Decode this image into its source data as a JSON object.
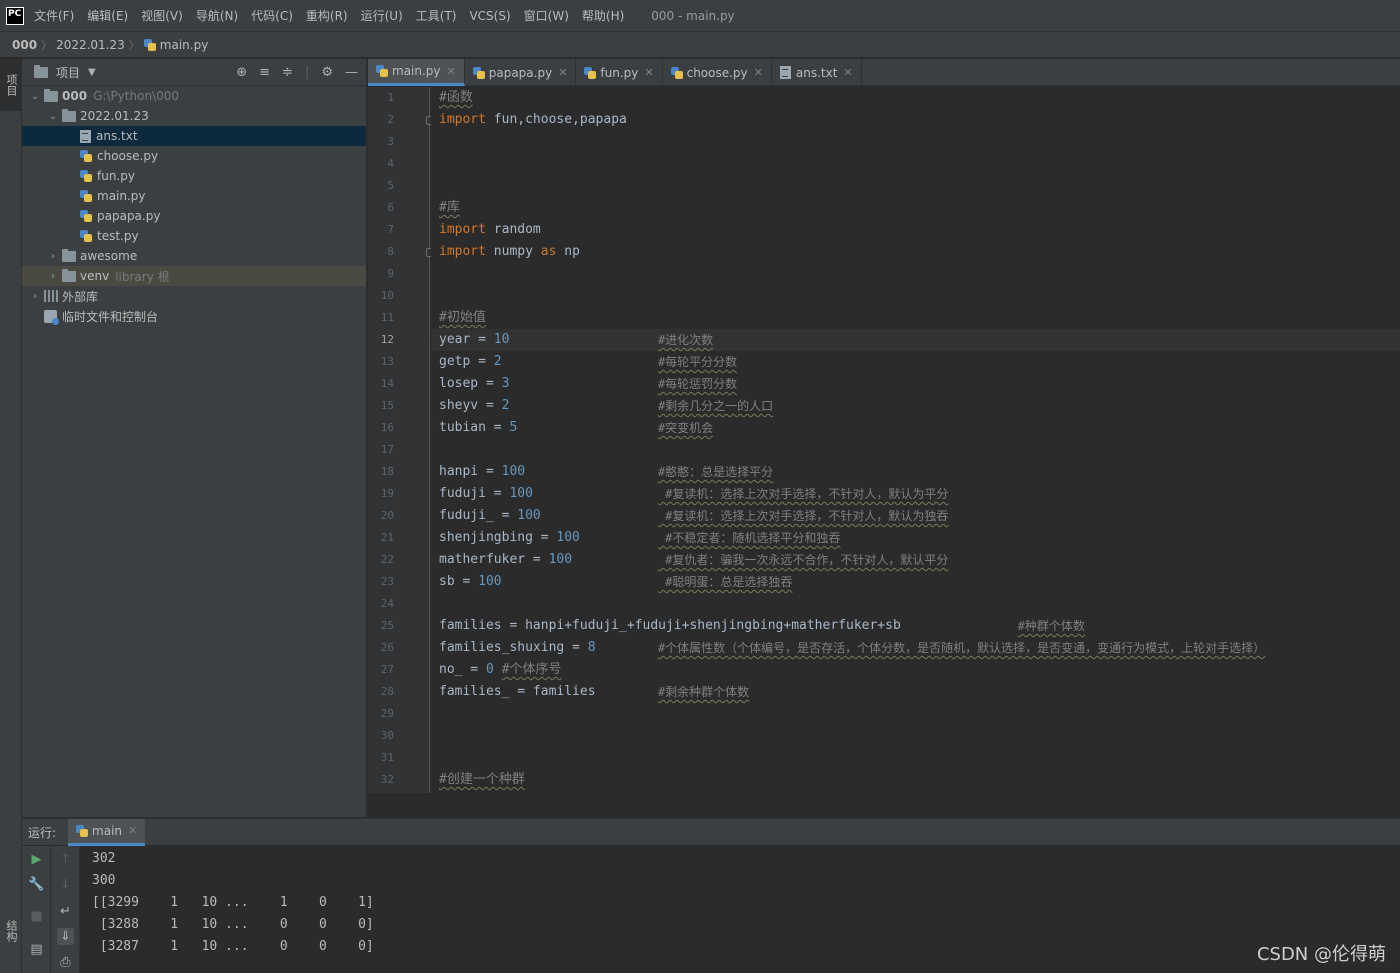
{
  "menubar": {
    "logo": "PC",
    "items": [
      "文件(F)",
      "编辑(E)",
      "视图(V)",
      "导航(N)",
      "代码(C)",
      "重构(R)",
      "运行(U)",
      "工具(T)",
      "VCS(S)",
      "窗口(W)",
      "帮助(H)"
    ],
    "window_title": "000 - main.py"
  },
  "breadcrumb": {
    "root": "000",
    "folder": "2022.01.23",
    "file": "main.py"
  },
  "left_strip": {
    "project_tab": "项目",
    "structure_tab": "结构"
  },
  "project_panel": {
    "title": "项目",
    "tree": [
      {
        "label": "000",
        "extra": "G:\\Python\\000",
        "type": "folder",
        "level": 0,
        "expanded": true
      },
      {
        "label": "2022.01.23",
        "extra": "",
        "type": "folder",
        "level": 1,
        "expanded": true
      },
      {
        "label": "ans.txt",
        "extra": "",
        "type": "txt",
        "level": 2,
        "selected": true
      },
      {
        "label": "choose.py",
        "extra": "",
        "type": "py",
        "level": 2
      },
      {
        "label": "fun.py",
        "extra": "",
        "type": "py",
        "level": 2
      },
      {
        "label": "main.py",
        "extra": "",
        "type": "py",
        "level": 2
      },
      {
        "label": "papapa.py",
        "extra": "",
        "type": "py",
        "level": 2
      },
      {
        "label": "test.py",
        "extra": "",
        "type": "py",
        "level": 2
      },
      {
        "label": "awesome",
        "extra": "",
        "type": "folder",
        "level": 1,
        "expanded": false
      },
      {
        "label": "venv",
        "extra": "library 根",
        "type": "folder",
        "level": 1,
        "expanded": false,
        "highlight": true
      },
      {
        "label": "外部库",
        "extra": "",
        "type": "lib",
        "level": 0,
        "expanded": false
      },
      {
        "label": "临时文件和控制台",
        "extra": "",
        "type": "scratch",
        "level": 0
      }
    ]
  },
  "editor": {
    "tabs": [
      {
        "label": "main.py",
        "icon": "py",
        "active": true
      },
      {
        "label": "papapa.py",
        "icon": "py"
      },
      {
        "label": "fun.py",
        "icon": "py"
      },
      {
        "label": "choose.py",
        "icon": "py"
      },
      {
        "label": "ans.txt",
        "icon": "txt"
      }
    ],
    "current_line": 12,
    "lines": [
      {
        "n": 1,
        "code": [
          [
            "cm",
            "#函数"
          ]
        ]
      },
      {
        "n": 2,
        "code": [
          [
            "kw",
            "import"
          ],
          [
            "",
            " fun,choose,papapa"
          ]
        ]
      },
      {
        "n": 3,
        "code": []
      },
      {
        "n": 4,
        "code": []
      },
      {
        "n": 5,
        "code": []
      },
      {
        "n": 6,
        "code": [
          [
            "cm",
            "#库"
          ]
        ]
      },
      {
        "n": 7,
        "code": [
          [
            "kw",
            "import"
          ],
          [
            "",
            " random"
          ]
        ]
      },
      {
        "n": 8,
        "code": [
          [
            "kw",
            "import"
          ],
          [
            "",
            " numpy "
          ],
          [
            "kw",
            "as"
          ],
          [
            "",
            " np"
          ]
        ]
      },
      {
        "n": 9,
        "code": []
      },
      {
        "n": 10,
        "code": []
      },
      {
        "n": 11,
        "code": [
          [
            "cm",
            "#初始值"
          ]
        ]
      },
      {
        "n": 12,
        "code": [
          [
            "",
            "year = "
          ],
          [
            "num",
            "10"
          ]
        ],
        "comment": "#进化次数"
      },
      {
        "n": 13,
        "code": [
          [
            "",
            "getp = "
          ],
          [
            "num",
            "2"
          ]
        ],
        "comment": "#每轮平分分数"
      },
      {
        "n": 14,
        "code": [
          [
            "",
            "losep = "
          ],
          [
            "num",
            "3"
          ]
        ],
        "comment": "#每轮惩罚分数"
      },
      {
        "n": 15,
        "code": [
          [
            "",
            "sheyv = "
          ],
          [
            "num",
            "2"
          ]
        ],
        "comment": "#剩余几分之一的人口"
      },
      {
        "n": 16,
        "code": [
          [
            "",
            "tubian = "
          ],
          [
            "num",
            "5"
          ]
        ],
        "comment": "#突变机会"
      },
      {
        "n": 17,
        "code": []
      },
      {
        "n": 18,
        "code": [
          [
            "",
            "hanpi = "
          ],
          [
            "num",
            "100"
          ]
        ],
        "comment": "#憨憨：总是选择平分"
      },
      {
        "n": 19,
        "code": [
          [
            "",
            "fuduji = "
          ],
          [
            "num",
            "100"
          ]
        ],
        "comment": " #复读机：选择上次对手选择，不针对人，默认为平分"
      },
      {
        "n": 20,
        "code": [
          [
            "",
            "fuduji_ = "
          ],
          [
            "num",
            "100"
          ]
        ],
        "comment": " #复读机：选择上次对手选择，不针对人，默认为独吞"
      },
      {
        "n": 21,
        "code": [
          [
            "",
            "shenjingbing = "
          ],
          [
            "num",
            "100"
          ]
        ],
        "comment": " #不稳定者：随机选择平分和独吞"
      },
      {
        "n": 22,
        "code": [
          [
            "",
            "matherfuker = "
          ],
          [
            "num",
            "100"
          ]
        ],
        "comment": " #复仇者：骗我一次永远不合作，不针对人，默认平分"
      },
      {
        "n": 23,
        "code": [
          [
            "",
            "sb = "
          ],
          [
            "num",
            "100"
          ]
        ],
        "comment": " #聪明蛋：总是选择独吞"
      },
      {
        "n": 24,
        "code": []
      },
      {
        "n": 25,
        "code": [
          [
            "",
            "families = hanpi+fuduji_+fuduji+shenjingbing+matherfuker+sb"
          ]
        ],
        "comment": "#种群个体数",
        "comment_col": 74
      },
      {
        "n": 26,
        "code": [
          [
            "",
            "families_shuxing = "
          ],
          [
            "num",
            "8"
          ]
        ],
        "comment": "#个体属性数（个体编号，是否存活，个体分数，是否随机，默认选择，是否变通，变通行为模式，上轮对手选择）"
      },
      {
        "n": 27,
        "code": [
          [
            "",
            "no_ = "
          ],
          [
            "num",
            "0"
          ],
          [
            "",
            " "
          ],
          [
            "cm",
            "#个体序号"
          ]
        ]
      },
      {
        "n": 28,
        "code": [
          [
            "",
            "families_ = families"
          ]
        ],
        "comment": "#剩余种群个体数"
      },
      {
        "n": 29,
        "code": []
      },
      {
        "n": 30,
        "code": []
      },
      {
        "n": 31,
        "code": []
      },
      {
        "n": 32,
        "code": [
          [
            "cm",
            "#创建一个种群"
          ]
        ]
      }
    ]
  },
  "run_panel": {
    "label": "运行:",
    "tab": "main",
    "output": [
      "302",
      "300",
      "[[3299    1   10 ...    1    0    1]",
      " [3288    1   10 ...    0    0    0]",
      " [3287    1   10 ...    0    0    0]"
    ]
  },
  "watermark": "CSDN @伦得萌",
  "colors": {
    "keyword": "#cc7832",
    "number": "#6897bb",
    "comment": "#808080",
    "text": "#a9b7c6",
    "accent": "#4a88c7"
  }
}
